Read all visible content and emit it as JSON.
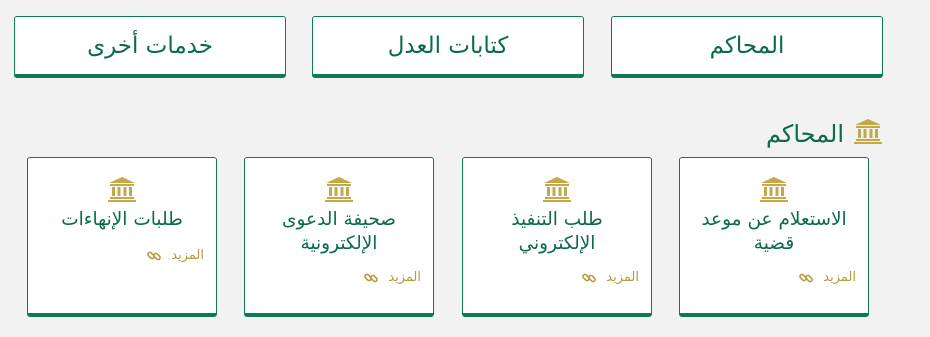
{
  "tabs": [
    {
      "label": "المحاكم"
    },
    {
      "label": "كتابات العدل"
    },
    {
      "label": "خدمات أخرى"
    }
  ],
  "section": {
    "title": "المحاكم",
    "icon": "courthouse-icon"
  },
  "cards": [
    {
      "title": "الاستعلام عن موعد قضية",
      "more_label": "المزيد",
      "icon": "courthouse-icon"
    },
    {
      "title": "طلب التنفيذ الإلكتروني",
      "more_label": "المزيد",
      "icon": "courthouse-icon"
    },
    {
      "title": "صحيفة الدعوى الإلكترونية",
      "more_label": "المزيد",
      "icon": "courthouse-icon"
    },
    {
      "title": "طلبات الإنهاءات",
      "more_label": "المزيد",
      "icon": "courthouse-icon"
    }
  ],
  "colors": {
    "primary_green": "#0b6b47",
    "accent_gold": "#b89a3c",
    "background": "#f2f2f2"
  }
}
